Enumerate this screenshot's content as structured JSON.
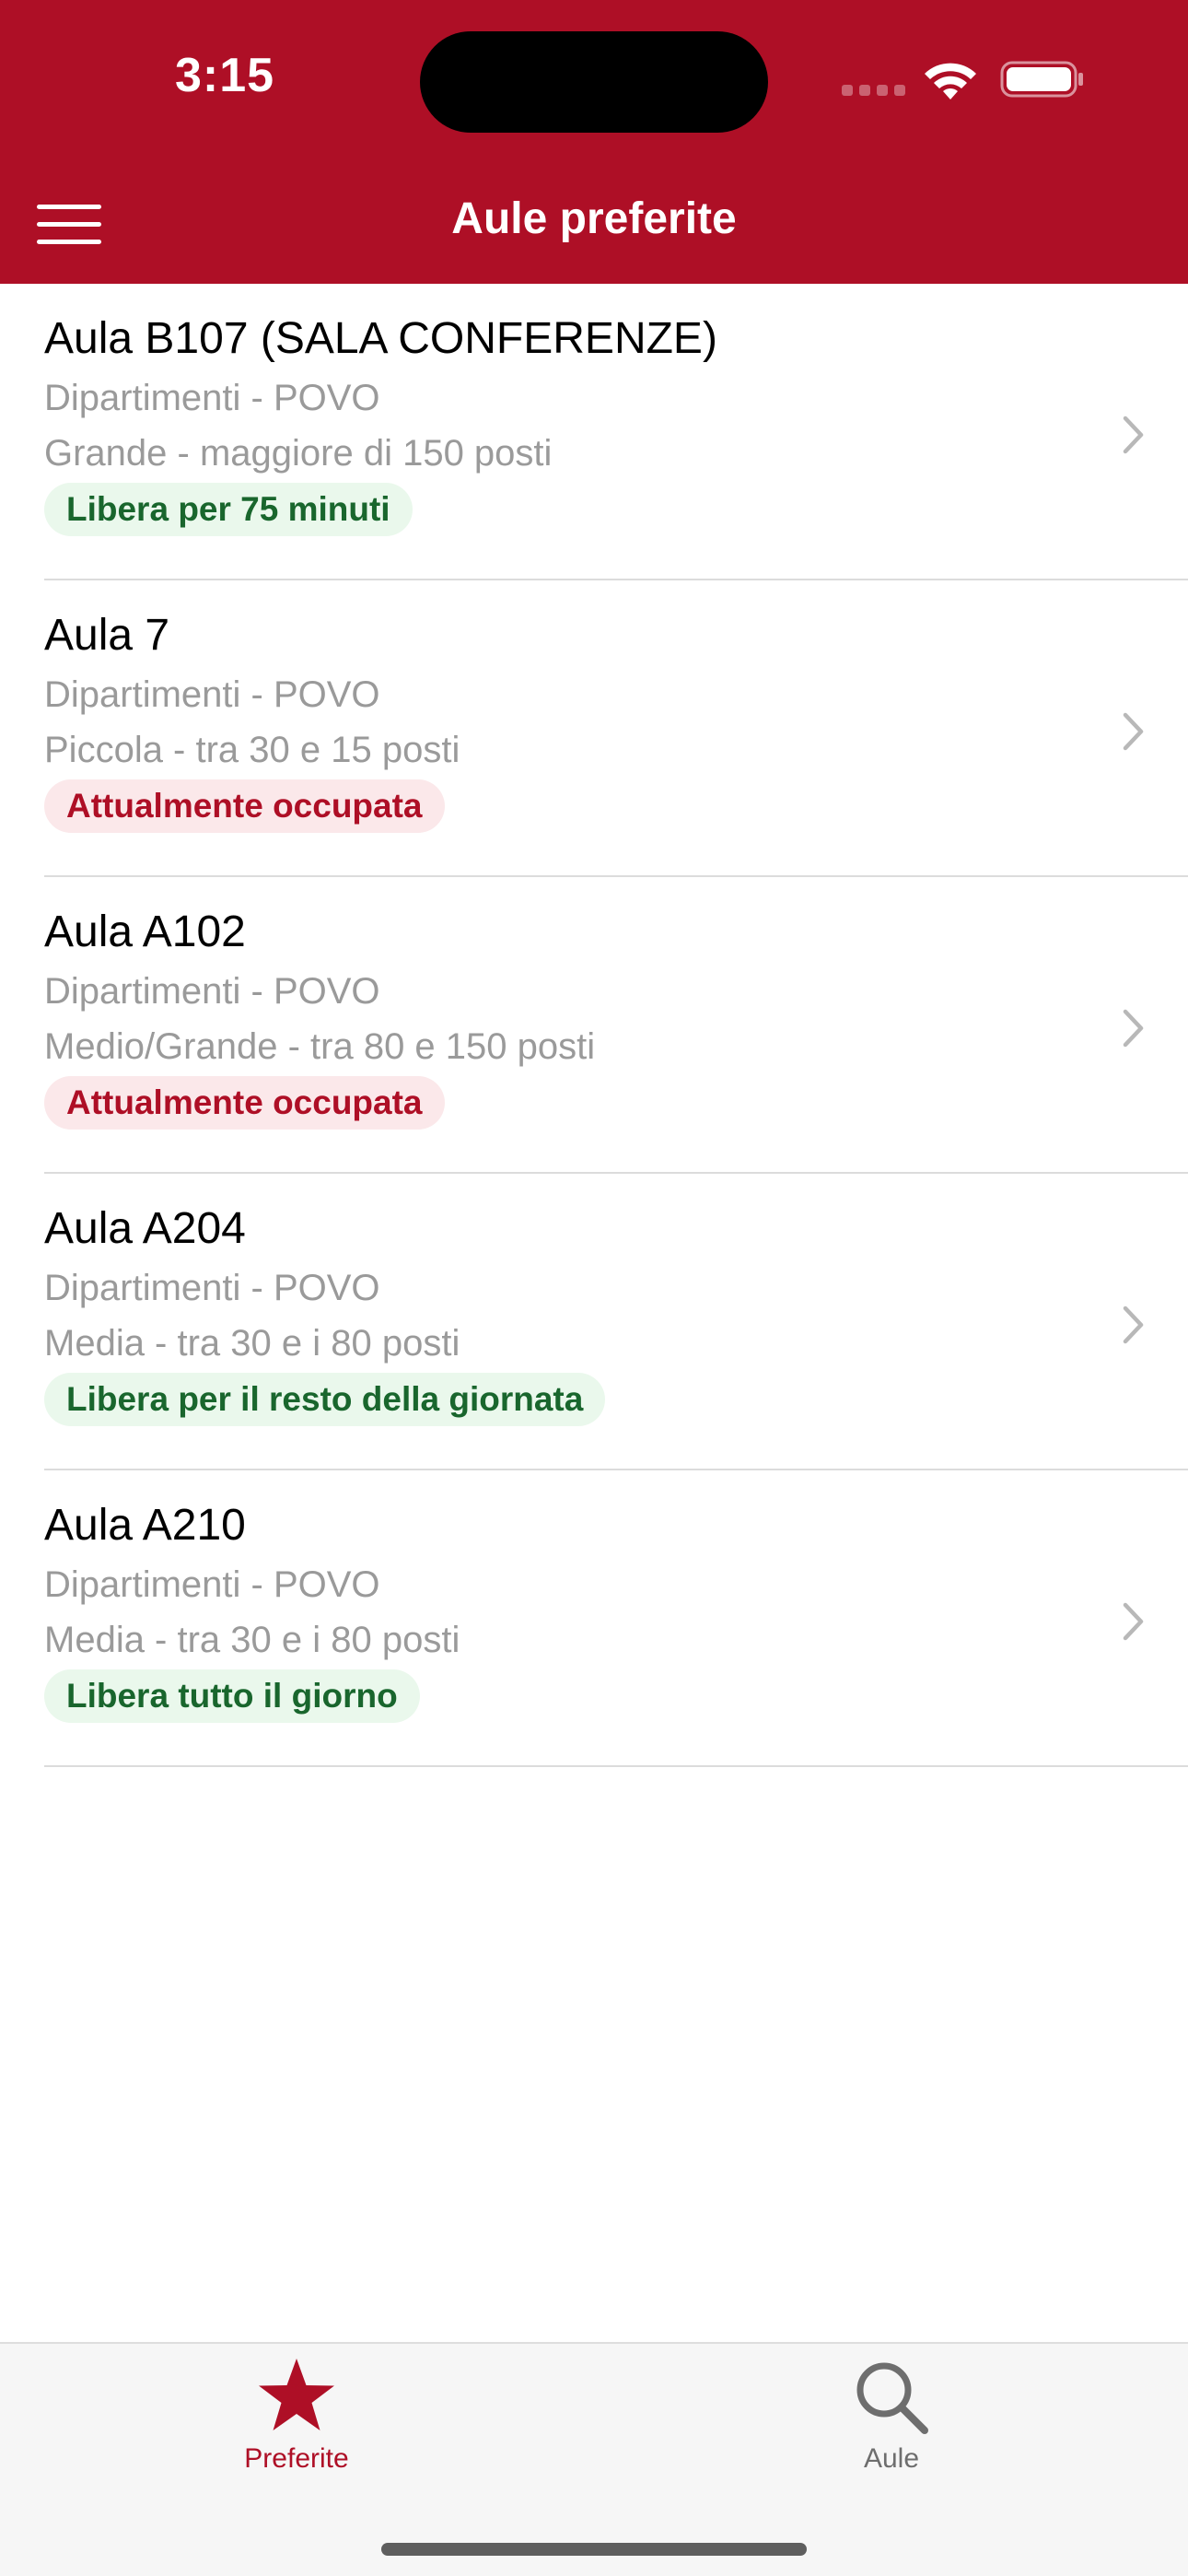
{
  "status_bar": {
    "time": "3:15"
  },
  "nav": {
    "title": "Aule preferite",
    "menu_icon": "hamburger-menu-icon"
  },
  "colors": {
    "brand": "#ae0f26",
    "free_text": "#19662d",
    "free_bg": "#eaf8ec",
    "busy_text": "#ae0f26",
    "busy_bg": "#fbe8ea"
  },
  "rooms": [
    {
      "title": "Aula B107 (SALA CONFERENZE)",
      "department": "Dipartimenti - POVO",
      "size": "Grande - maggiore di 150 posti",
      "status": "Libera per 75 minuti",
      "status_type": "free"
    },
    {
      "title": "Aula 7",
      "department": "Dipartimenti - POVO",
      "size": "Piccola - tra 30 e 15 posti",
      "status": "Attualmente occupata",
      "status_type": "busy"
    },
    {
      "title": "Aula A102",
      "department": "Dipartimenti - POVO",
      "size": "Medio/Grande - tra 80 e 150 posti",
      "status": "Attualmente occupata",
      "status_type": "busy"
    },
    {
      "title": "Aula A204",
      "department": "Dipartimenti - POVO",
      "size": "Media - tra 30 e i 80 posti",
      "status": "Libera per il resto della giornata",
      "status_type": "free"
    },
    {
      "title": "Aula A210",
      "department": "Dipartimenti - POVO",
      "size": "Media - tra 30 e i 80 posti",
      "status": "Libera tutto il giorno",
      "status_type": "free"
    }
  ],
  "tabbar": {
    "favorites": {
      "label": "Preferite",
      "icon": "star-icon",
      "selected": true
    },
    "search": {
      "label": "Aule",
      "icon": "search-icon",
      "selected": false
    }
  }
}
